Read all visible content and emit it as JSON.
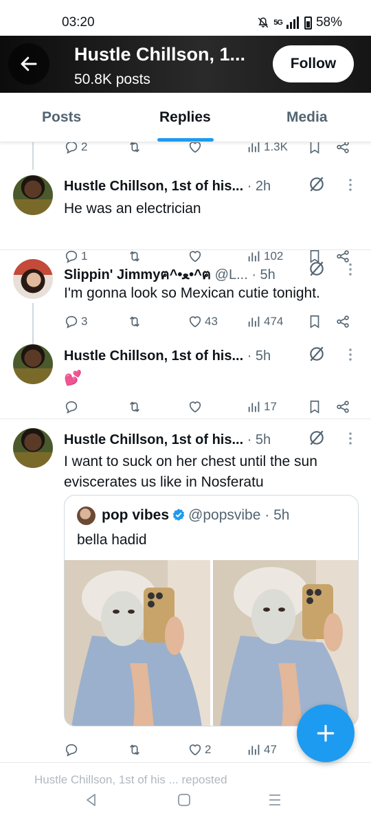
{
  "status": {
    "time": "03:20",
    "network": "5G",
    "battery": "58%"
  },
  "header": {
    "title": "Hustle Chillson, 1...",
    "subtitle": "50.8K posts",
    "follow_label": "Follow"
  },
  "tabs": [
    {
      "label": "Posts"
    },
    {
      "label": "Replies",
      "active": true
    },
    {
      "label": "Media"
    }
  ],
  "partial_tweet": {
    "replies": "2",
    "views": "1.3K"
  },
  "tweets": [
    {
      "name": "Hustle Chillson, 1st of his...",
      "meta": " · 2h",
      "text": "He was an electrician",
      "replies": "1",
      "retweets": "",
      "likes": "",
      "views": "102"
    },
    {
      "name": "Slippin' Jimmyฅ^•ﻌ•^ฅ",
      "meta": " @L... · 5h",
      "text": "I'm gonna look so Mexican cutie tonight.",
      "replies": "3",
      "retweets": "",
      "likes": "43",
      "views": "474"
    },
    {
      "name": "Hustle Chillson, 1st of his...",
      "meta": " · 5h",
      "text": "💕",
      "replies": "",
      "retweets": "",
      "likes": "",
      "views": "17"
    },
    {
      "name": "Hustle Chillson, 1st of his...",
      "meta": " · 5h",
      "text": "I want to suck on her chest until the sun eviscerates us like in Nosferatu",
      "replies": "",
      "retweets": "",
      "likes": "2",
      "views": "47",
      "quote": {
        "name": "pop vibes",
        "handle": "@popsvibe · 5h",
        "text": "bella hadid"
      }
    }
  ],
  "bottom_peek": "Hustle Chillson, 1st of his ... reposted",
  "colors": {
    "accent": "#1d9bf0",
    "text": "#0f1419",
    "muted": "#536471"
  }
}
